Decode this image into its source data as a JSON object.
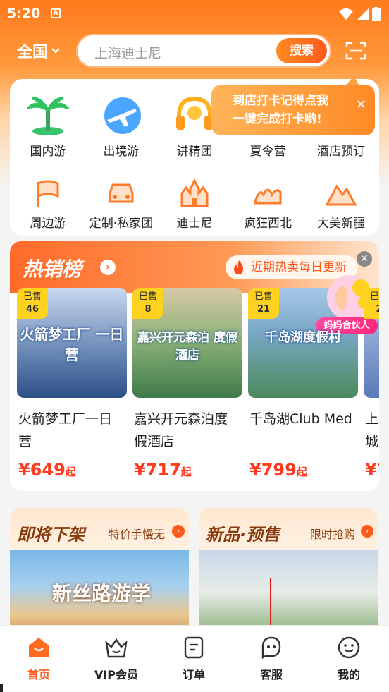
{
  "status": {
    "time": "5:20"
  },
  "topbar": {
    "region": "全国",
    "search_placeholder": "上海迪士尼",
    "search_button": "搜索"
  },
  "categories_row1": [
    {
      "label": "国内游",
      "icon": "palm-tree-icon"
    },
    {
      "label": "出境游",
      "icon": "airplane-globe-icon"
    },
    {
      "label": "讲精团",
      "icon": "headset-icon"
    },
    {
      "label": "夏令营",
      "icon": "camp-icon"
    },
    {
      "label": "酒店预订",
      "icon": "hotel-icon"
    }
  ],
  "categories_row2": [
    {
      "label": "周边游",
      "icon": "flag-icon"
    },
    {
      "label": "定制·私家团",
      "icon": "car-icon"
    },
    {
      "label": "迪士尼",
      "icon": "castle-icon"
    },
    {
      "label": "疯狂西北",
      "icon": "camel-icon"
    },
    {
      "label": "大美新疆",
      "icon": "mountain-icon"
    }
  ],
  "tooltip": {
    "line1": "到店打卡记得点我",
    "line2": "一键完成打卡哟!"
  },
  "hot": {
    "title": "热销榜",
    "pill": "近期热卖每日更新",
    "products": [
      {
        "sold_label": "已售",
        "sold": "46",
        "img_text": "火箭梦工厂 一日营",
        "name": "火箭梦工厂一日营",
        "price": "¥649",
        "suffix": "起"
      },
      {
        "sold_label": "已售",
        "sold": "8",
        "img_text": "嘉兴开元森泊 度假酒店",
        "name": "嘉兴开元森泊度假酒店",
        "price": "¥717",
        "suffix": "起"
      },
      {
        "sold_label": "已售",
        "sold": "21",
        "img_text": "千岛湖度假村",
        "name": "千岛湖Club Med",
        "price": "¥799",
        "suffix": "起"
      },
      {
        "sold_label": "已售",
        "sold": "2",
        "img_text": "",
        "name": "上城",
        "price": "¥7",
        "suffix": ""
      }
    ]
  },
  "floater": {
    "label": "妈妈合伙人"
  },
  "promos": [
    {
      "title": "即将下架",
      "subtitle": "特价手慢无",
      "img_text": "新丝路游学"
    },
    {
      "title": "新品·预售",
      "subtitle": "限时抢购",
      "img_text": ""
    }
  ],
  "tabs": [
    {
      "label": "首页",
      "icon": "home-icon",
      "active": true
    },
    {
      "label": "VIP会员",
      "icon": "vip-crown-icon",
      "active": false
    },
    {
      "label": "订单",
      "icon": "order-list-icon",
      "active": false
    },
    {
      "label": "客服",
      "icon": "service-chat-icon",
      "active": false
    },
    {
      "label": "我的",
      "icon": "profile-smile-icon",
      "active": false
    }
  ],
  "colors": {
    "accent": "#ff5a1e",
    "price": "#ff3a1e",
    "badge": "#ffd21f"
  }
}
